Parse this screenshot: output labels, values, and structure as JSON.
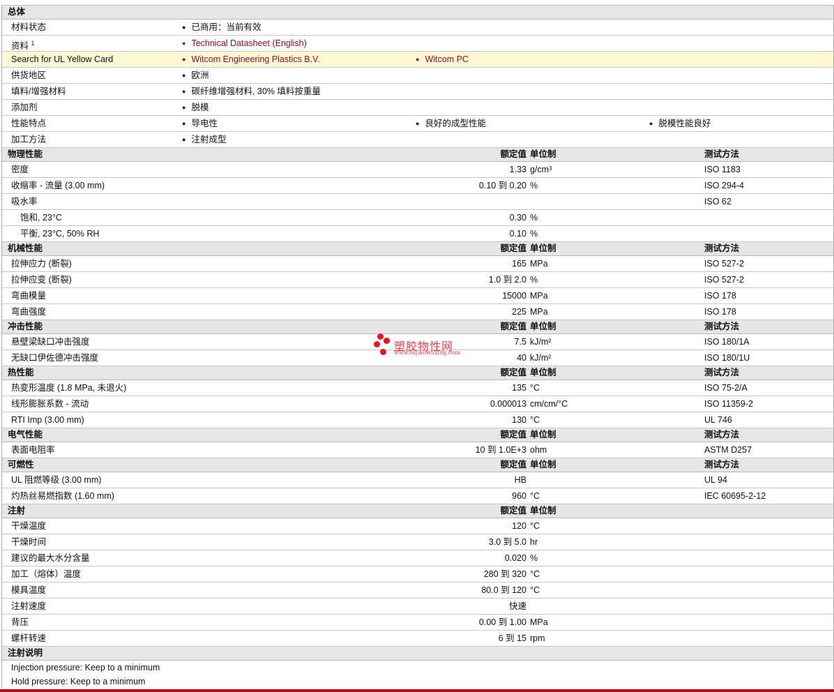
{
  "general": {
    "title": "总体",
    "rows": [
      {
        "label": "材料状态",
        "items": [
          "已商用：当前有效"
        ]
      },
      {
        "label": "资料",
        "sup": "1",
        "items": [
          "Technical Datasheet (English)"
        ],
        "link": true
      },
      {
        "label": "Search for UL Yellow Card",
        "items": [
          "Witcom Engineering Plastics B.V.",
          "Witcom PC"
        ],
        "link": true,
        "highlight": true
      },
      {
        "label": "供货地区",
        "items": [
          "欧洲"
        ]
      },
      {
        "label": "填料/增强材料",
        "items": [
          "碳纤维增强材料, 30% 填料按重量"
        ]
      },
      {
        "label": "添加剂",
        "items": [
          "脱模"
        ]
      },
      {
        "label": "性能特点",
        "items": [
          "导电性",
          "良好的成型性能",
          "脱模性能良好"
        ]
      },
      {
        "label": "加工方法",
        "items": [
          "注射成型"
        ]
      }
    ]
  },
  "headers": {
    "value": "额定值",
    "unit": "单位制",
    "test": "测试方法"
  },
  "sections": [
    {
      "title": "物理性能",
      "test_header": true,
      "rows": [
        {
          "label": "密度",
          "value": "1.33",
          "unit": "g/cm³",
          "test": "ISO 1183"
        },
        {
          "label": "收缩率  - 流量  (3.00 mm)",
          "value": "0.10 到  0.20",
          "unit": "%",
          "test": "ISO 294-4"
        },
        {
          "label": "吸水率",
          "value": "",
          "unit": "",
          "test": "ISO 62"
        },
        {
          "label": "饱和, 23°C",
          "sub": true,
          "value": "0.30",
          "unit": "%",
          "test": ""
        },
        {
          "label": "平衡, 23°C, 50% RH",
          "sub": true,
          "value": "0.10",
          "unit": "%",
          "test": ""
        }
      ]
    },
    {
      "title": "机械性能",
      "test_header": true,
      "rows": [
        {
          "label": "拉伸应力  (断裂)",
          "value": "165",
          "unit": "MPa",
          "test": "ISO 527-2"
        },
        {
          "label": "拉伸应变  (断裂)",
          "value": "1.0 到  2.0",
          "unit": "%",
          "test": "ISO 527-2"
        },
        {
          "label": "弯曲模量",
          "value": "15000",
          "unit": "MPa",
          "test": "ISO 178"
        },
        {
          "label": "弯曲强度",
          "value": "225",
          "unit": "MPa",
          "test": "ISO 178"
        }
      ]
    },
    {
      "title": "冲击性能",
      "test_header": true,
      "rows": [
        {
          "label": "悬壁梁缺口冲击强度",
          "value": "7.5",
          "unit": "kJ/m²",
          "test": "ISO 180/1A"
        },
        {
          "label": "无缺口伊佐德冲击强度",
          "value": "40",
          "unit": "kJ/m²",
          "test": "ISO 180/1U"
        }
      ]
    },
    {
      "title": "热性能",
      "test_header": true,
      "rows": [
        {
          "label": "热变形温度  (1.8 MPa, 未退火)",
          "value": "135",
          "unit": "°C",
          "test": "ISO 75-2/A"
        },
        {
          "label": "线形膨胀系数  - 流动",
          "value": "0.000013",
          "unit": "cm/cm/°C",
          "test": "ISO 11359-2"
        },
        {
          "label": "RTI Imp  (3.00 mm)",
          "value": "130",
          "unit": "°C",
          "test": "UL 746"
        }
      ]
    },
    {
      "title": "电气性能",
      "test_header": true,
      "rows": [
        {
          "label": "表面电阻率",
          "value": "10 到  1.0E+3",
          "unit": "ohm",
          "test": "ASTM D257"
        }
      ]
    },
    {
      "title": "可燃性",
      "test_header": true,
      "rows": [
        {
          "label": "UL 阻燃等级  (3.00 mm)",
          "value": "HB",
          "unit": "",
          "test": "UL 94"
        },
        {
          "label": "灼热丝易燃指数  (1.60 mm)",
          "value": "960",
          "unit": "°C",
          "test": "IEC 60695-2-12"
        }
      ]
    },
    {
      "title": "注射",
      "test_header": false,
      "rows": [
        {
          "label": "干燥温度",
          "value": "120",
          "unit": "°C",
          "test": ""
        },
        {
          "label": "干燥时间",
          "value": "3.0 到  5.0",
          "unit": "hr",
          "test": ""
        },
        {
          "label": "建议的最大水分含量",
          "value": "0.020",
          "unit": "%",
          "test": ""
        },
        {
          "label": "加工（熔体）温度",
          "value": "280 到  320",
          "unit": "°C",
          "test": ""
        },
        {
          "label": "模具温度",
          "value": "80.0 到  120",
          "unit": "°C",
          "test": ""
        },
        {
          "label": "注射速度",
          "value": "快速",
          "unit": "",
          "test": ""
        },
        {
          "label": "背压",
          "value": "0.00 到  1.00",
          "unit": "MPa",
          "test": ""
        },
        {
          "label": "螺杆转速",
          "value": "6 到  15",
          "unit": "rpm",
          "test": ""
        }
      ]
    }
  ],
  "notes": {
    "title": "注射说明",
    "lines": [
      "Injection pressure: Keep to a minimum",
      "Hold pressure: Keep to a minimum"
    ]
  },
  "watermark": {
    "name": "塑胶物性网",
    "url": "www.sujiaowuxing.com"
  }
}
